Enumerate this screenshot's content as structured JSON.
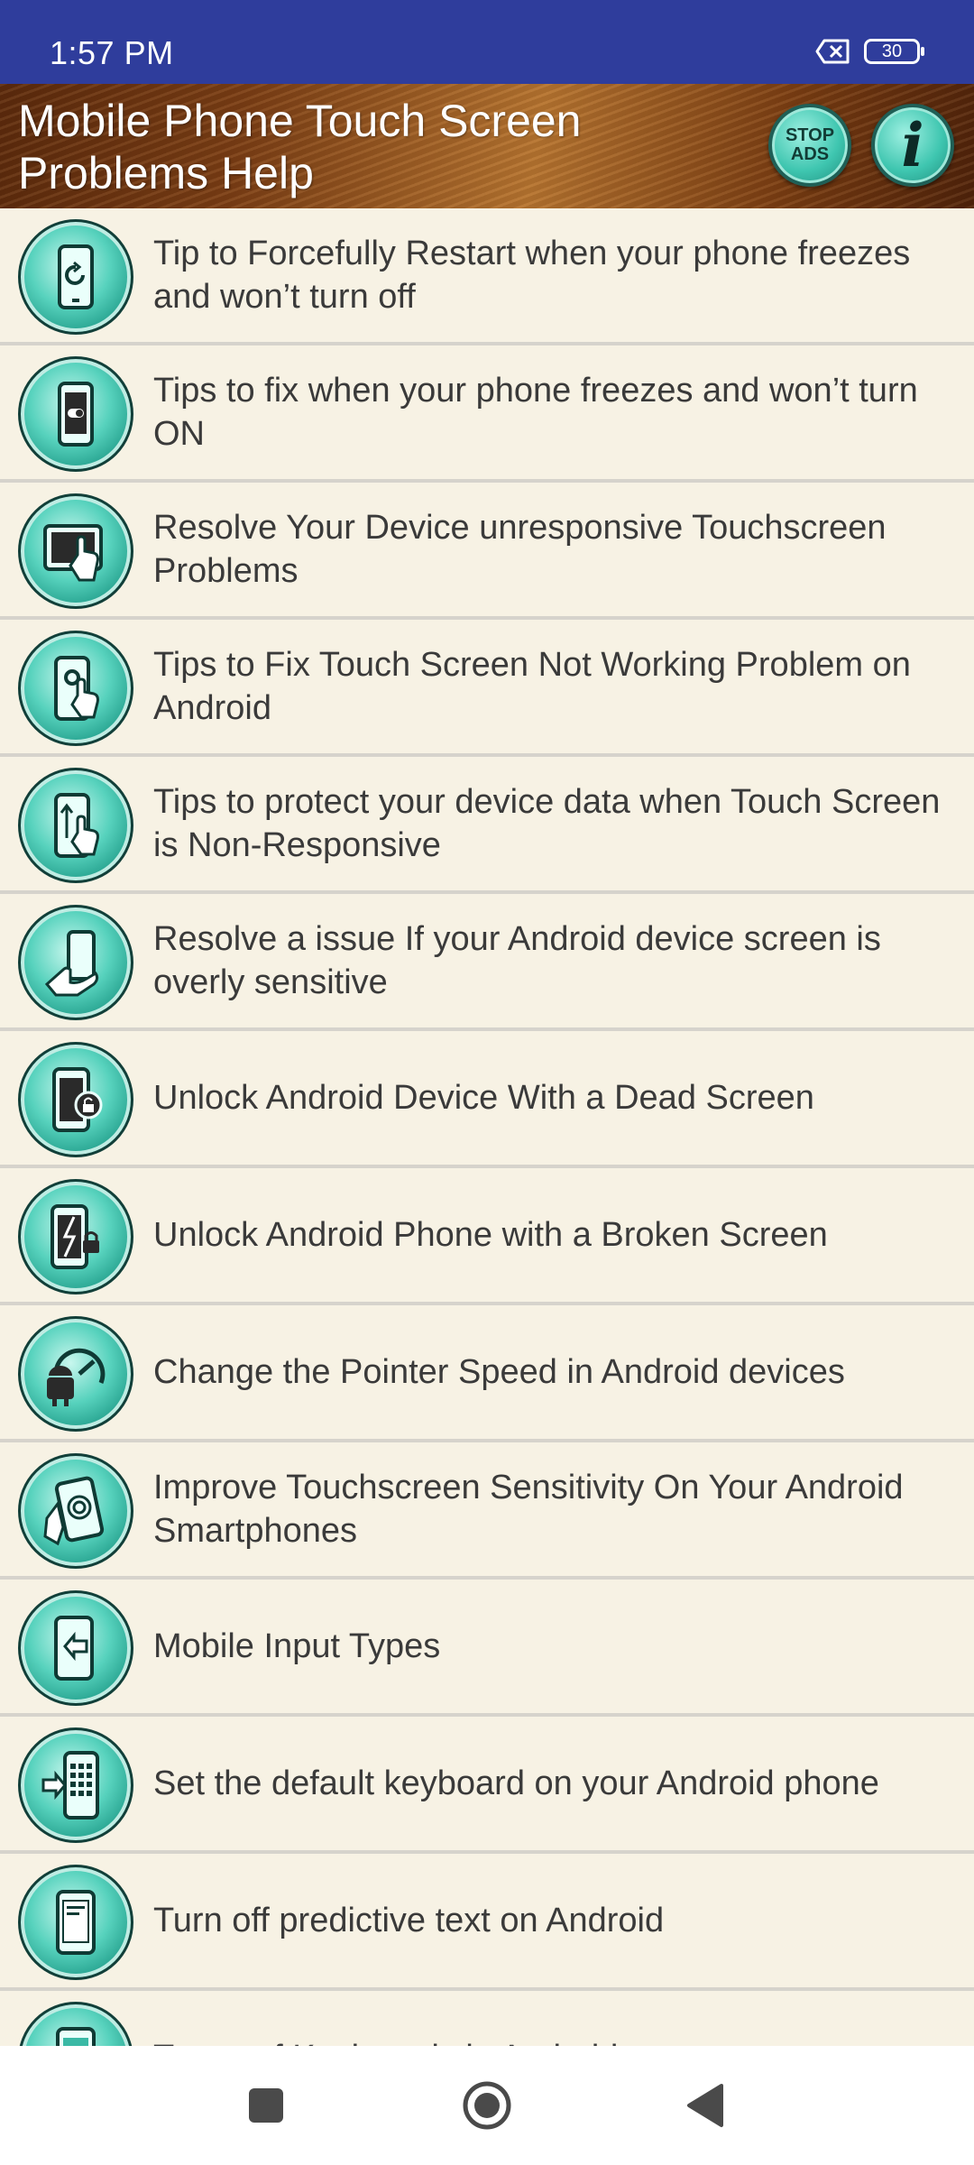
{
  "status_bar": {
    "time": "1:57 PM",
    "battery_level": "30"
  },
  "header": {
    "title": "Mobile Phone Touch Screen Problems Help",
    "stop_ads_label": "STOP ADS",
    "info_label": "i"
  },
  "items": [
    {
      "label": "Tip to Forcefully Restart when your phone freezes and won’t turn off",
      "icon": "phone-restart-icon"
    },
    {
      "label": "Tips to fix when your phone freezes and won’t turn ON",
      "icon": "phone-power-toggle-icon"
    },
    {
      "label": "Resolve Your Device unresponsive Touchscreen Problems",
      "icon": "tablet-touch-icon"
    },
    {
      "label": "Tips to Fix Touch Screen Not Working Problem on Android",
      "icon": "phone-gear-touch-icon"
    },
    {
      "label": "Tips to protect your device data when Touch Screen is Non-Responsive",
      "icon": "phone-swipe-icon"
    },
    {
      "label": "Resolve a issue If your Android device screen is overly sensitive",
      "icon": "hand-holding-phone-icon"
    },
    {
      "label": "Unlock Android Device With a Dead Screen",
      "icon": "phone-lock-icon"
    },
    {
      "label": "Unlock Android Phone with a Broken Screen",
      "icon": "broken-phone-lock-icon"
    },
    {
      "label": "Change the Pointer Speed in Android devices",
      "icon": "android-speedometer-icon"
    },
    {
      "label": "Improve Touchscreen Sensitivity On Your Android Smartphones",
      "icon": "phone-fingerprint-icon"
    },
    {
      "label": "Mobile Input Types",
      "icon": "phone-input-arrow-icon"
    },
    {
      "label": "Set the default keyboard on your Android phone",
      "icon": "phone-keyboard-icon"
    },
    {
      "label": "Turn off predictive text on Android",
      "icon": "phone-text-icon"
    },
    {
      "label": "Types of Keyboards in Android",
      "icon": "phone-icon"
    }
  ],
  "colors": {
    "status_bar": "#2f3d9c",
    "list_background": "#f7f2e4",
    "icon_teal": "#3fc6b0",
    "divider": "#d6d3cc"
  }
}
